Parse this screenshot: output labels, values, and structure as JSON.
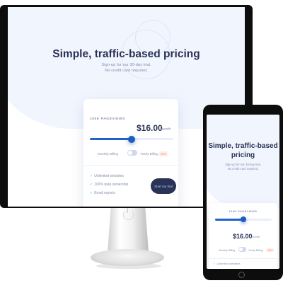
{
  "hero": {
    "title": "Simple, traffic-based pricing",
    "subtitle_line1": "Sign-up for our 30-day trial.",
    "subtitle_line2": "No credit card required.",
    "mobile_title_line1": "Simple, traffic-based",
    "mobile_title_line2": "pricing"
  },
  "pricing": {
    "pageviews_label": "100K PAGEVIEWS",
    "price": "$16.00",
    "period": "/month",
    "slider_level": 0.5,
    "billing_monthly": "Monthly Billing",
    "billing_yearly": "Yearly Billing",
    "discount_desktop": "25%",
    "discount_mobile": "-25%",
    "features": [
      "Unlimited websites",
      "100% data ownership",
      "Email reports"
    ],
    "cta_label": "Start my trial"
  },
  "colors": {
    "hero_bg": "#f1f5fe",
    "title": "#293356",
    "muted": "#858fad",
    "slider": "#1f63c6",
    "check": "#10d5c2",
    "discount": "#ff8c66",
    "cta_bg": "#293356"
  }
}
